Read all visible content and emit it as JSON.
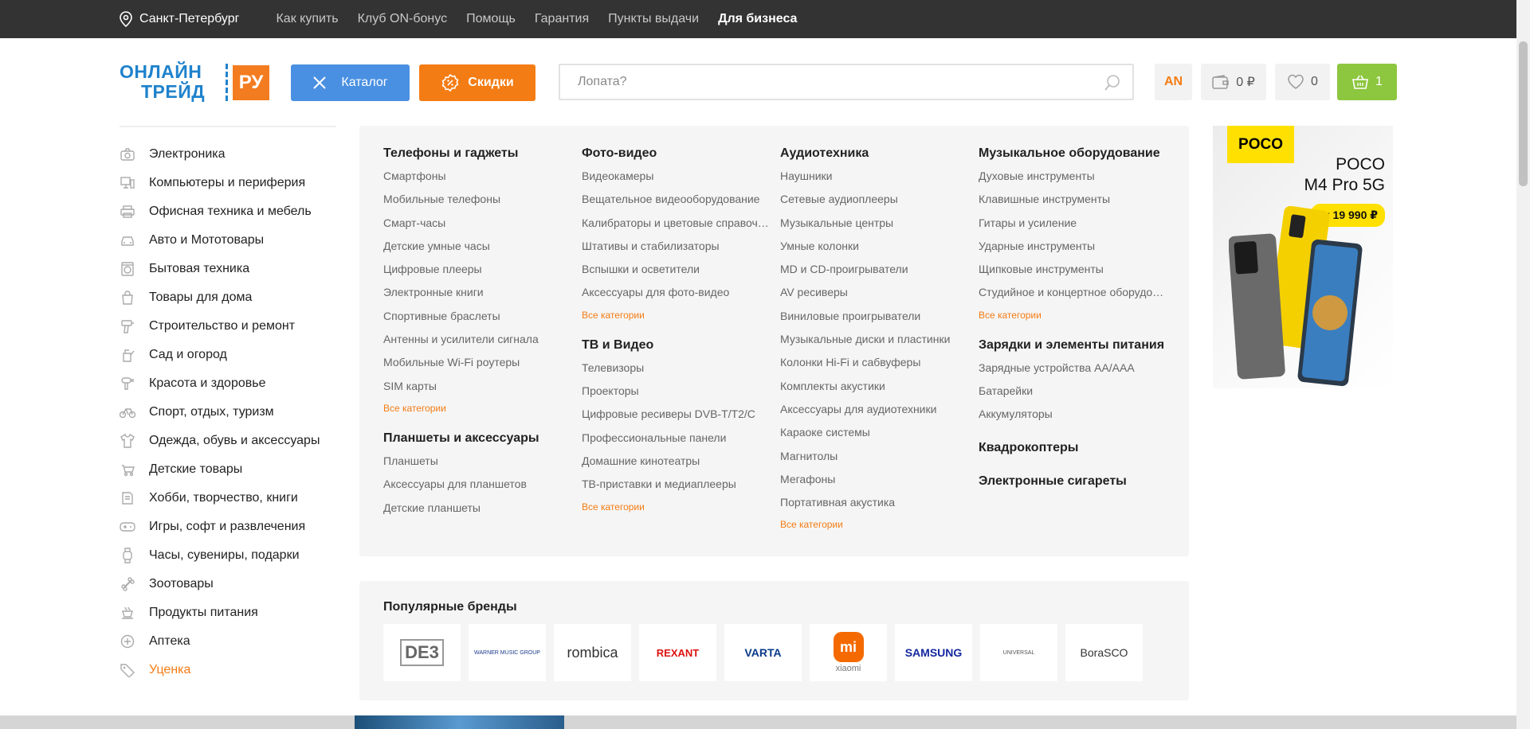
{
  "topbar": {
    "city": "Санкт-Петербург",
    "links": [
      "Как купить",
      "Клуб ON-бонус",
      "Помощь",
      "Гарантия",
      "Пункты выдачи"
    ],
    "business": "Для бизнеса"
  },
  "header": {
    "logo_line1": "ОНЛАЙН",
    "logo_line2": "ТРЕЙД",
    "logo_ru": "РУ",
    "catalog_label": "Каталог",
    "sale_label": "Скидки",
    "search_placeholder": "Лопата?",
    "user_initials": "AN",
    "wallet_balance": "0 ₽",
    "favorites_count": "0",
    "cart_count": "1",
    "accent_orange": "#f47c14",
    "accent_blue": "#4a90e2",
    "cart_green": "#8dc63f"
  },
  "sidebar": {
    "items": [
      {
        "label": "Электроника",
        "icon": "camera-icon"
      },
      {
        "label": "Компьютеры и периферия",
        "icon": "computer-icon"
      },
      {
        "label": "Офисная техника и мебель",
        "icon": "printer-icon"
      },
      {
        "label": "Авто и Мототовары",
        "icon": "car-icon"
      },
      {
        "label": "Бытовая техника",
        "icon": "washer-icon"
      },
      {
        "label": "Товары для дома",
        "icon": "home-bag-icon"
      },
      {
        "label": "Строительство и ремонт",
        "icon": "drill-icon"
      },
      {
        "label": "Сад и огород",
        "icon": "watering-can-icon"
      },
      {
        "label": "Красота и здоровье",
        "icon": "hairdryer-icon"
      },
      {
        "label": "Спорт, отдых, туризм",
        "icon": "bicycle-icon"
      },
      {
        "label": "Одежда, обувь и аксессуары",
        "icon": "shirt-icon"
      },
      {
        "label": "Детские товары",
        "icon": "stroller-icon"
      },
      {
        "label": "Хобби, творчество, книги",
        "icon": "book-icon"
      },
      {
        "label": "Игры, софт и развлечения",
        "icon": "gamepad-icon"
      },
      {
        "label": "Часы, сувениры, подарки",
        "icon": "watch-icon"
      },
      {
        "label": "Зоотовары",
        "icon": "bone-icon"
      },
      {
        "label": "Продукты питания",
        "icon": "cup-icon"
      },
      {
        "label": "Аптека",
        "icon": "pharmacy-icon"
      },
      {
        "label": "Уценка",
        "icon": "tag-icon"
      }
    ]
  },
  "mega": {
    "all_label": "Все категории",
    "col1": [
      {
        "title": "Телефоны и гаджеты",
        "items": [
          "Смартфоны",
          "Мобильные телефоны",
          "Смарт-часы",
          "Детские умные часы",
          "Цифровые плееры",
          "Электронные книги",
          "Спортивные браслеты",
          "Антенны и усилители сигнала",
          "Мобильные Wi-Fi роутеры",
          "SIM карты"
        ]
      },
      {
        "title": "Планшеты и аксессуары",
        "items": [
          "Планшеты",
          "Аксессуары для планшетов",
          "Детские планшеты"
        ]
      }
    ],
    "col2": [
      {
        "title": "Фото-видео",
        "items": [
          "Видеокамеры",
          "Вещательное видеооборудование",
          "Калибраторы и цветовые справочники",
          "Штативы и стабилизаторы",
          "Вспышки и осветители",
          "Аксессуары для фото-видео"
        ]
      },
      {
        "title": "ТВ и Видео",
        "items": [
          "Телевизоры",
          "Проекторы",
          "Цифровые ресиверы DVB-T/T2/C",
          "Профессиональные панели",
          "Домашние кинотеатры",
          "ТВ-приставки и медиаплееры"
        ]
      }
    ],
    "col3": [
      {
        "title": "Аудиотехника",
        "items": [
          "Наушники",
          "Сетевые аудиоплееры",
          "Музыкальные центры",
          "Умные колонки",
          "MD и CD-проигрыватели",
          "AV ресиверы",
          "Виниловые проигрыватели",
          "Музыкальные диски и пластинки",
          "Колонки Hi-Fi и сабвуферы",
          "Комплекты акустики",
          "Аксессуары для аудиотехники",
          "Караоке системы",
          "Магнитолы",
          "Мегафоны",
          "Портативная акустика"
        ]
      }
    ],
    "col4": [
      {
        "title": "Музыкальное оборудование",
        "items": [
          "Духовые инструменты",
          "Клавишные инструменты",
          "Гитары и усиление",
          "Ударные инструменты",
          "Щипковые инструменты",
          "Студийное и концертное оборудование"
        ]
      },
      {
        "title": "Зарядки и элементы питания",
        "items": [
          "Зарядные устройства AA/AAA",
          "Батарейки",
          "Аккумуляторы"
        ]
      }
    ],
    "col4_solo": [
      "Квадрокоптеры",
      "Электронные сигареты"
    ]
  },
  "promo": {
    "brand": "POCO",
    "title_line1": "POCO",
    "title_line2": "M4 Pro 5G",
    "price": "от 19 990 ₽",
    "brand_color": "#ffe000"
  },
  "brands": {
    "title": "Популярные бренды",
    "list": [
      "DE3",
      "WARNER MUSIC GROUP",
      "rombica",
      "REXANT",
      "VARTA",
      "xiaomi",
      "SAMSUNG",
      "UNIVERSAL",
      "BoraSCO"
    ]
  }
}
